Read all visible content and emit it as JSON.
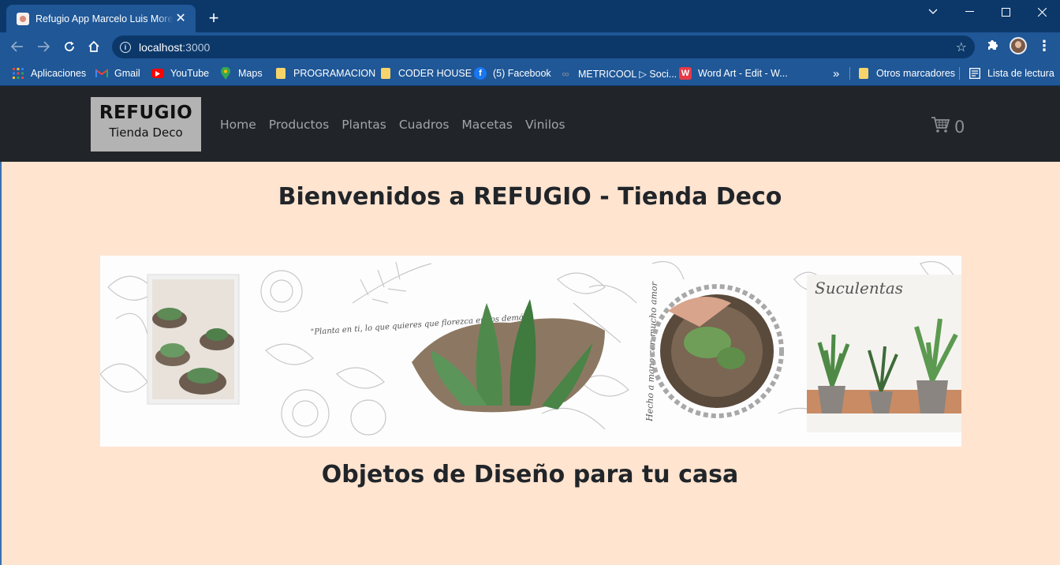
{
  "browser": {
    "tab_title": "Refugio App Marcelo Luis Moreno",
    "url_host": "localhost",
    "url_port": ":3000",
    "bookmarks": [
      {
        "label": "Aplicaciones",
        "icon": "apps-grid-icon"
      },
      {
        "label": "Gmail",
        "icon": "gmail-icon"
      },
      {
        "label": "YouTube",
        "icon": "youtube-icon"
      },
      {
        "label": "Maps",
        "icon": "maps-icon"
      },
      {
        "label": "PROGRAMACION",
        "icon": "folder-icon"
      },
      {
        "label": "CODER HOUSE",
        "icon": "folder-icon"
      },
      {
        "label": "(5) Facebook",
        "icon": "facebook-icon"
      },
      {
        "label": "METRICOOL ▷ Soci...",
        "icon": "metricool-icon"
      },
      {
        "label": "Word Art - Edit - W...",
        "icon": "wordart-icon"
      }
    ],
    "other_bookmarks": "Otros marcadores",
    "reading_list": "Lista de lectura",
    "overflow": "»"
  },
  "site": {
    "logo_main": "REFUGIO",
    "logo_sub": "Tienda Deco",
    "nav": [
      "Home",
      "Productos",
      "Plantas",
      "Cuadros",
      "Macetas",
      "Vinilos"
    ],
    "cart_count": "0"
  },
  "page": {
    "title": "Bienvenidos a REFUGIO - Tienda Deco",
    "subtitle": "Objetos de Diseño para tu casa"
  },
  "banner": {
    "quote": "\"Planta en ti, lo que quieres que florezca en los demás\"",
    "vertical_text": "Hecho a mano con mucho amor",
    "heading": "Suculentas"
  },
  "colors": {
    "chrome_dark": "#0c3869",
    "chrome": "#1f5797",
    "navbar": "#212529",
    "page_bg": "#ffe4d0"
  }
}
